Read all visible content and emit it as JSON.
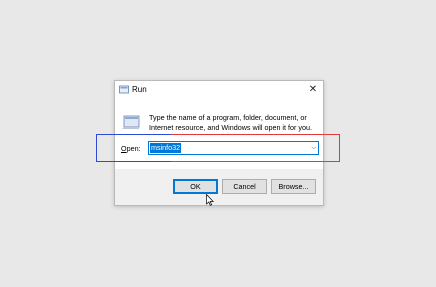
{
  "dialog": {
    "title": "Run",
    "close_glyph": "✕",
    "description": "Type the name of a program, folder, document, or Internet resource, and Windows will open it for you.",
    "open_label_accel": "O",
    "open_label_rest": "pen:",
    "open_value": "msinfo32",
    "dropdown_glyph": "⌵",
    "buttons": {
      "ok": "OK",
      "cancel": "Cancel",
      "browse": "Browse..."
    }
  },
  "icons": {
    "title_icon": "run-icon",
    "content_icon": "run-program-icon",
    "close": "close-icon",
    "dropdown": "chevron-down-icon",
    "cursor": "mouse-cursor-icon"
  },
  "colors": {
    "accent": "#0078d7",
    "highlight_blue": "#2f4ad8",
    "highlight_red": "#e03a3a"
  }
}
